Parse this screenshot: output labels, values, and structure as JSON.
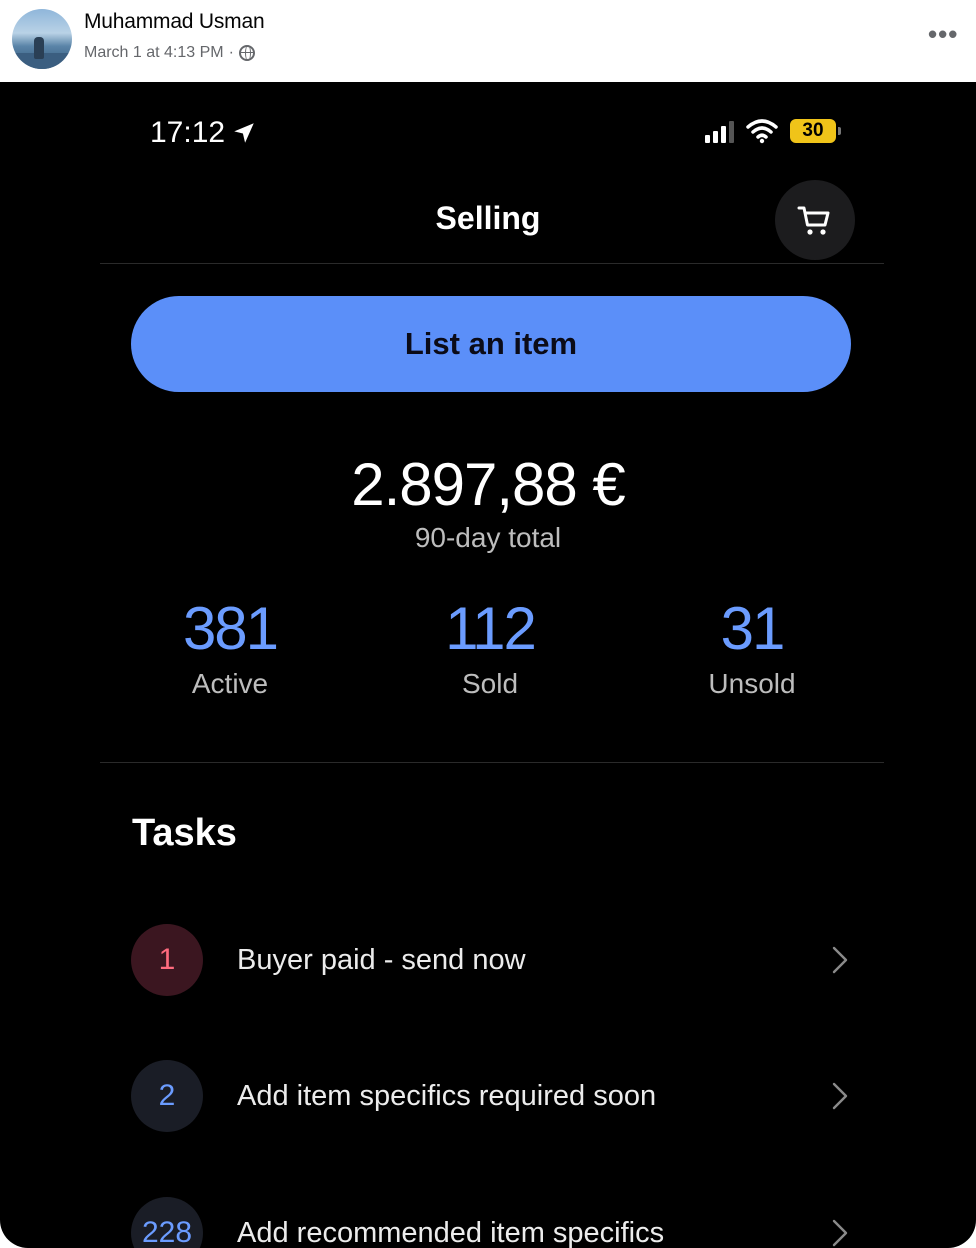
{
  "post": {
    "author": "Muhammad Usman",
    "timestamp": "March 1 at 4:13 PM",
    "separator": "·",
    "more_icon": "more-horizontal-icon",
    "privacy_icon": "globe-icon"
  },
  "status_bar": {
    "time": "17:12",
    "battery": "30"
  },
  "nav": {
    "title": "Selling",
    "cart_icon": "cart-icon"
  },
  "actions": {
    "list_item_label": "List an item"
  },
  "summary": {
    "total": "2.897,88 €",
    "total_label": "90-day total"
  },
  "stats": [
    {
      "value": "381",
      "label": "Active"
    },
    {
      "value": "112",
      "label": "Sold"
    },
    {
      "value": "31",
      "label": "Unsold"
    }
  ],
  "tasks": {
    "title": "Tasks",
    "items": [
      {
        "count": "1",
        "label": "Buyer paid - send now"
      },
      {
        "count": "2",
        "label": "Add item specifics required soon"
      },
      {
        "count": "228",
        "label": "Add recommended item specifics"
      }
    ]
  },
  "colors": {
    "accent_button": "#5b8ff9",
    "stat_blue": "#6b9cff",
    "alert_red": "#ff6b7e",
    "battery_yellow": "#f0c419"
  }
}
